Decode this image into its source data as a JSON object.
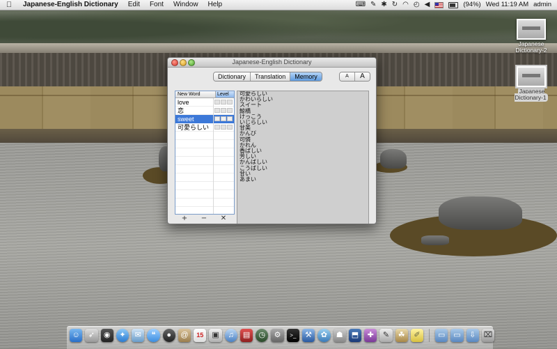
{
  "menubar": {
    "app_name": "Japanese-English Dictionary",
    "menus": [
      "Edit",
      "Font",
      "Window",
      "Help"
    ],
    "battery": "(94%)",
    "clock": "Wed 11:19 AM",
    "user": "admin"
  },
  "desktop": {
    "icons": [
      {
        "label": "Japanese Dictionary-2"
      },
      {
        "label": "Japanese Dictionary-1"
      }
    ]
  },
  "window": {
    "title": "Japanese-English Dictionary",
    "tabs": [
      {
        "label": "Dictionary",
        "active": false
      },
      {
        "label": "Translation",
        "active": false
      },
      {
        "label": "Memory",
        "active": true
      }
    ],
    "font_smaller": "A",
    "font_larger": "A",
    "table": {
      "col_word": "New Word",
      "col_level": "Level",
      "rows": [
        {
          "word": "love",
          "selected": false
        },
        {
          "word": "恋",
          "selected": false
        },
        {
          "word": "sweet",
          "selected": true
        },
        {
          "word": "可愛らしい",
          "selected": false
        }
      ]
    },
    "add_label": "+",
    "remove_label": "−",
    "clear_label": "✕",
    "results": [
      "可愛らしい",
      "かわいらしい",
      "スイート",
      "鯨橋",
      "けっこう",
      "いじらしい",
      "甘美",
      "かんび",
      "可憐",
      "かれん",
      "香ばしい",
      "芳しい",
      "かんばしい",
      "こうばしい",
      "甘い",
      "あまい"
    ]
  },
  "dock": {
    "items": [
      "finder-icon",
      "rocket-icon",
      "dashboard-icon",
      "safari-icon",
      "mail-icon",
      "ichat-icon",
      "camera-icon",
      "addressbook-icon",
      "calendar-icon",
      "preview-icon",
      "itunes-icon",
      "photobooth-icon",
      "timemachine-icon",
      "systemprefs-icon",
      "terminal-icon",
      "xcode-icon",
      "iphoto-icon",
      "app1-icon",
      "app2-icon",
      "app3-icon",
      "script-icon",
      "app4-icon",
      "stickies-icon",
      "folder-icon",
      "folder2-icon",
      "downloads-icon",
      "trash-icon"
    ]
  }
}
